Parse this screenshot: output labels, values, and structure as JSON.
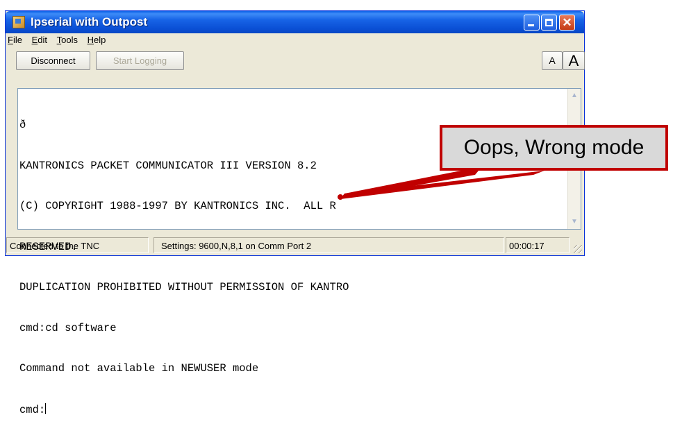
{
  "window": {
    "title": "Ipserial with Outpost",
    "controls": {
      "minimize": "minimize",
      "maximize": "maximize",
      "close": "✕"
    }
  },
  "menu": [
    {
      "underline": "F",
      "rest": "ile"
    },
    {
      "underline": "E",
      "rest": "dit"
    },
    {
      "underline": "T",
      "rest": "ools"
    },
    {
      "underline": "H",
      "rest": "elp"
    }
  ],
  "toolbar": {
    "disconnect_label": "Disconnect",
    "start_logging_label": "Start Logging",
    "font_small_label": "A",
    "font_large_label": "A"
  },
  "terminal": {
    "lines": [
      "ð",
      "KANTRONICS PACKET COMMUNICATOR III VERSION 8.2",
      "(C) COPYRIGHT 1988-1997 BY KANTRONICS INC.  ALL R",
      "RESERVED.",
      "DUPLICATION PROHIBITED WITHOUT PERMISSION OF KANTRO",
      "cmd:cd software",
      "Command not available in NEWUSER mode"
    ],
    "prompt": "cmd:"
  },
  "status": {
    "connection": "Connected to the TNC",
    "settings": "Settings: 9600,N,8,1 on Comm Port 2",
    "timer": "00:00:17"
  },
  "annotation": {
    "callout_text": "Oops, Wrong mode",
    "color": "#c00000"
  }
}
